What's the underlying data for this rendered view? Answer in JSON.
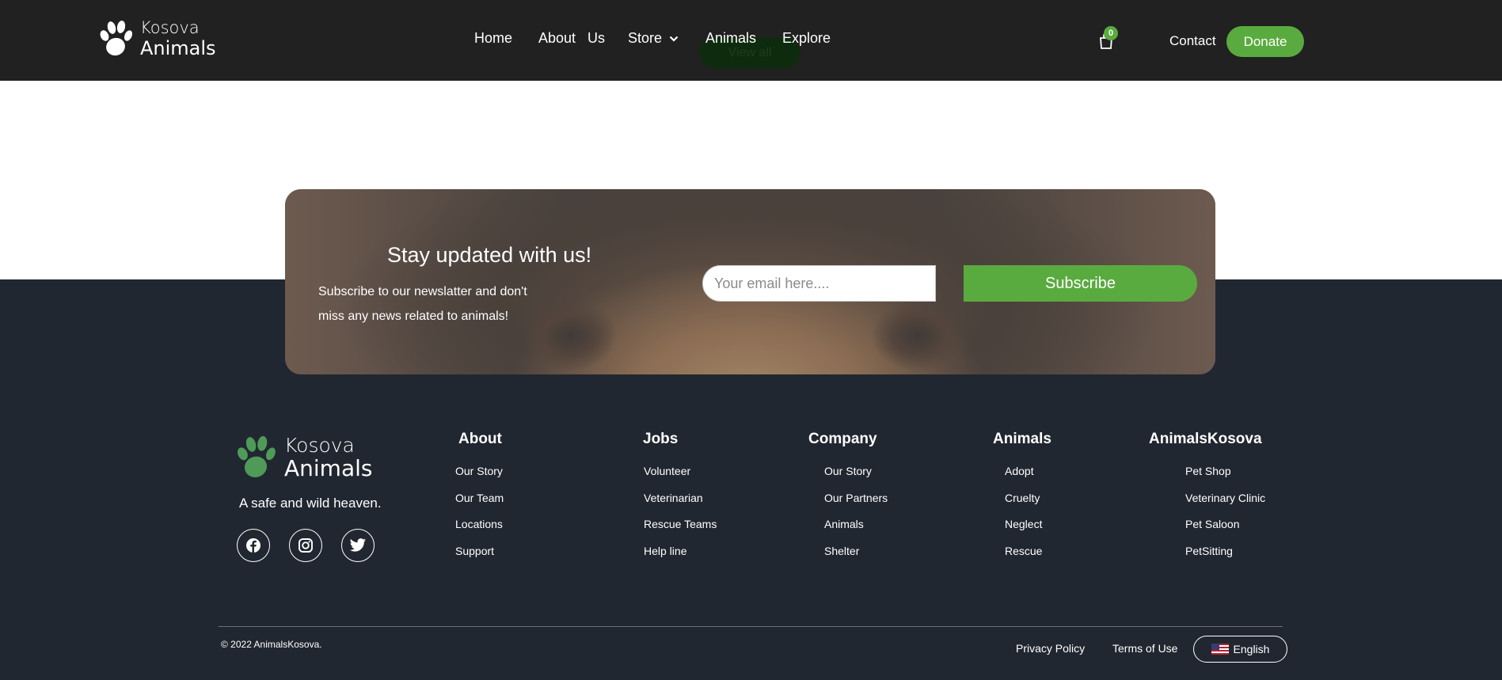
{
  "header": {
    "logo": {
      "line1": "Kosova",
      "line2": "Animals"
    },
    "nav": [
      {
        "label": "Home"
      },
      {
        "label": "About   Us"
      },
      {
        "label": "Store"
      },
      {
        "label": "Animals"
      },
      {
        "label": "Explore"
      }
    ],
    "hidden_button": "View all",
    "cart_count": "0",
    "contact": "Contact",
    "donate": "Donate"
  },
  "newsletter": {
    "title": "Stay updated with us!",
    "text": "Subscribe to our newslatter and don't miss any news related to animals!",
    "email_placeholder": "Your email here....",
    "subscribe_label": "Subscribe"
  },
  "footer": {
    "logo": {
      "line1": "Kosova",
      "line2": "Animals"
    },
    "tagline": "A safe and wild heaven.",
    "social": [
      "facebook-icon",
      "instagram-icon",
      "twitter-icon"
    ],
    "columns": [
      {
        "title": "About",
        "links": [
          "Our Story",
          "Our Team",
          "Locations",
          "Support"
        ]
      },
      {
        "title": "Jobs",
        "links": [
          "Volunteer",
          "Veterinarian",
          "Rescue Teams",
          "Help line"
        ]
      },
      {
        "title": "Company",
        "links": [
          "Our Story",
          "Our Partners",
          "Animals",
          "Shelter"
        ]
      },
      {
        "title": "Animals",
        "links": [
          "Adopt",
          "Cruelty",
          "Neglect",
          "Rescue"
        ]
      },
      {
        "title": "AnimalsKosova",
        "links": [
          "Pet Shop",
          "Veterinary Clinic",
          "Pet Saloon",
          "PetSitting"
        ]
      }
    ],
    "copyright": "© 2022 AnimalsKosova.",
    "privacy": "Privacy Policy",
    "terms": "Terms of Use",
    "language": "English"
  },
  "colors": {
    "accent": "#5aab3f",
    "header_bg": "#212121",
    "footer_bg": "#212731"
  }
}
